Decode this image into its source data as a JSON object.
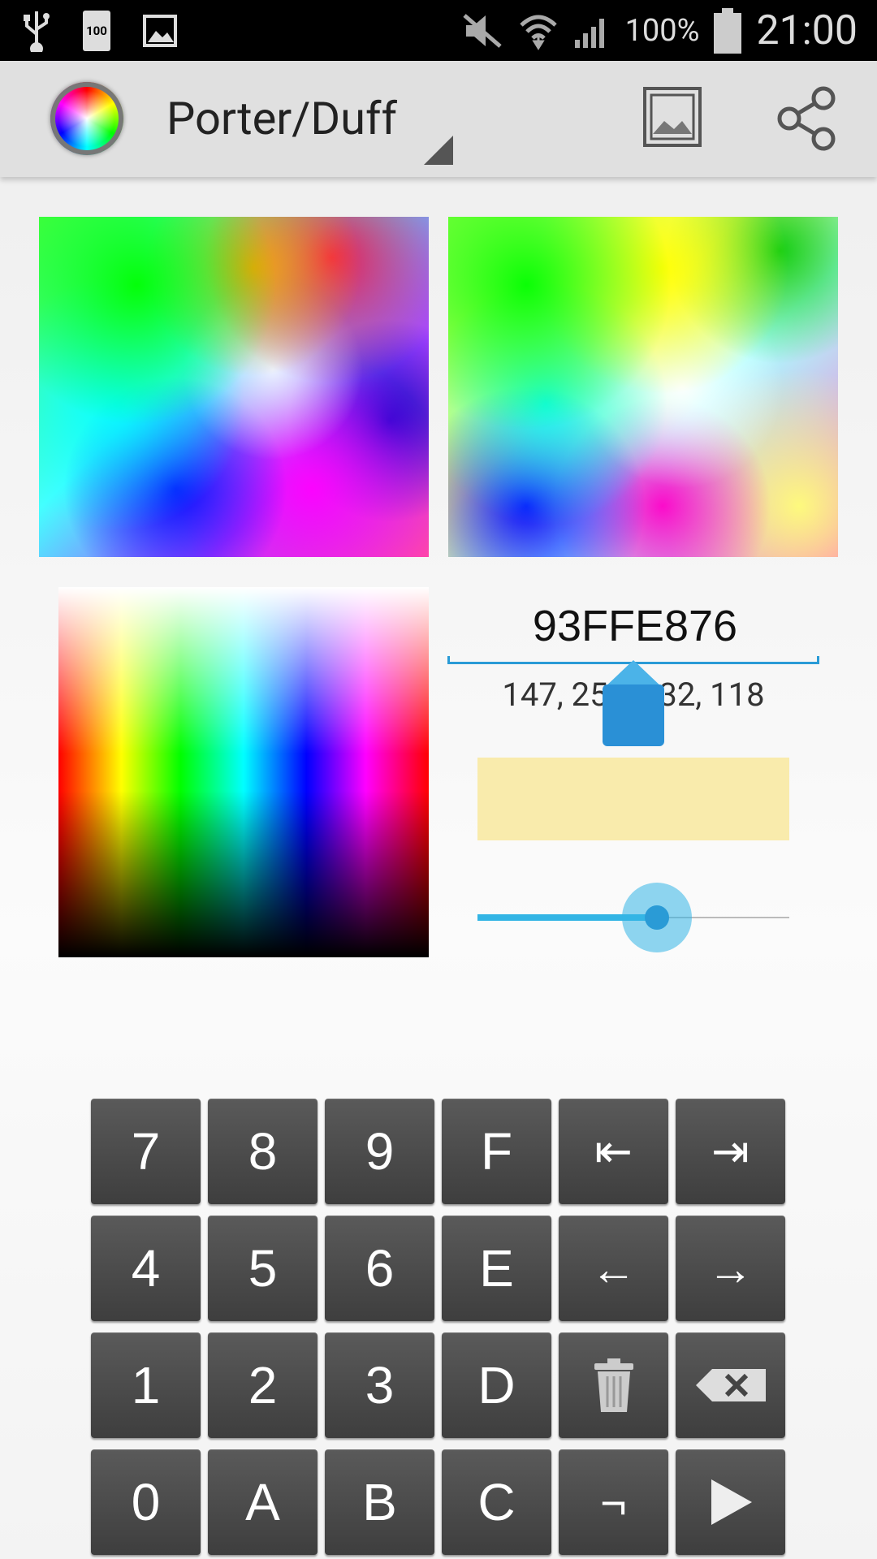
{
  "status_bar": {
    "battery_badge": "100",
    "battery_percent": "100%",
    "time": "21:00",
    "icons": [
      "usb-icon",
      "battery-icon",
      "image-icon",
      "mute-icon",
      "wifi-icon",
      "signal-icon",
      "battery-icon"
    ]
  },
  "action_bar": {
    "app_icon": "color-wheel-icon",
    "mode_title": "Porter/Duff",
    "actions": [
      "image-icon",
      "share-icon"
    ]
  },
  "color": {
    "hex": "93FFE876",
    "rgba": "147, 255, 232, 118",
    "swatch_color": "#f9ebac",
    "accent": "#33b5e5"
  },
  "slider": {
    "fraction": 0.575
  },
  "keypad": {
    "rows": [
      [
        "7",
        "8",
        "9",
        "F",
        "⇤",
        "⇥"
      ],
      [
        "4",
        "5",
        "6",
        "E",
        "←",
        "→"
      ],
      [
        "1",
        "2",
        "3",
        "D",
        "trash-icon",
        "backspace-icon"
      ],
      [
        "0",
        "A",
        "B",
        "C",
        "¬",
        "play-icon"
      ]
    ]
  }
}
